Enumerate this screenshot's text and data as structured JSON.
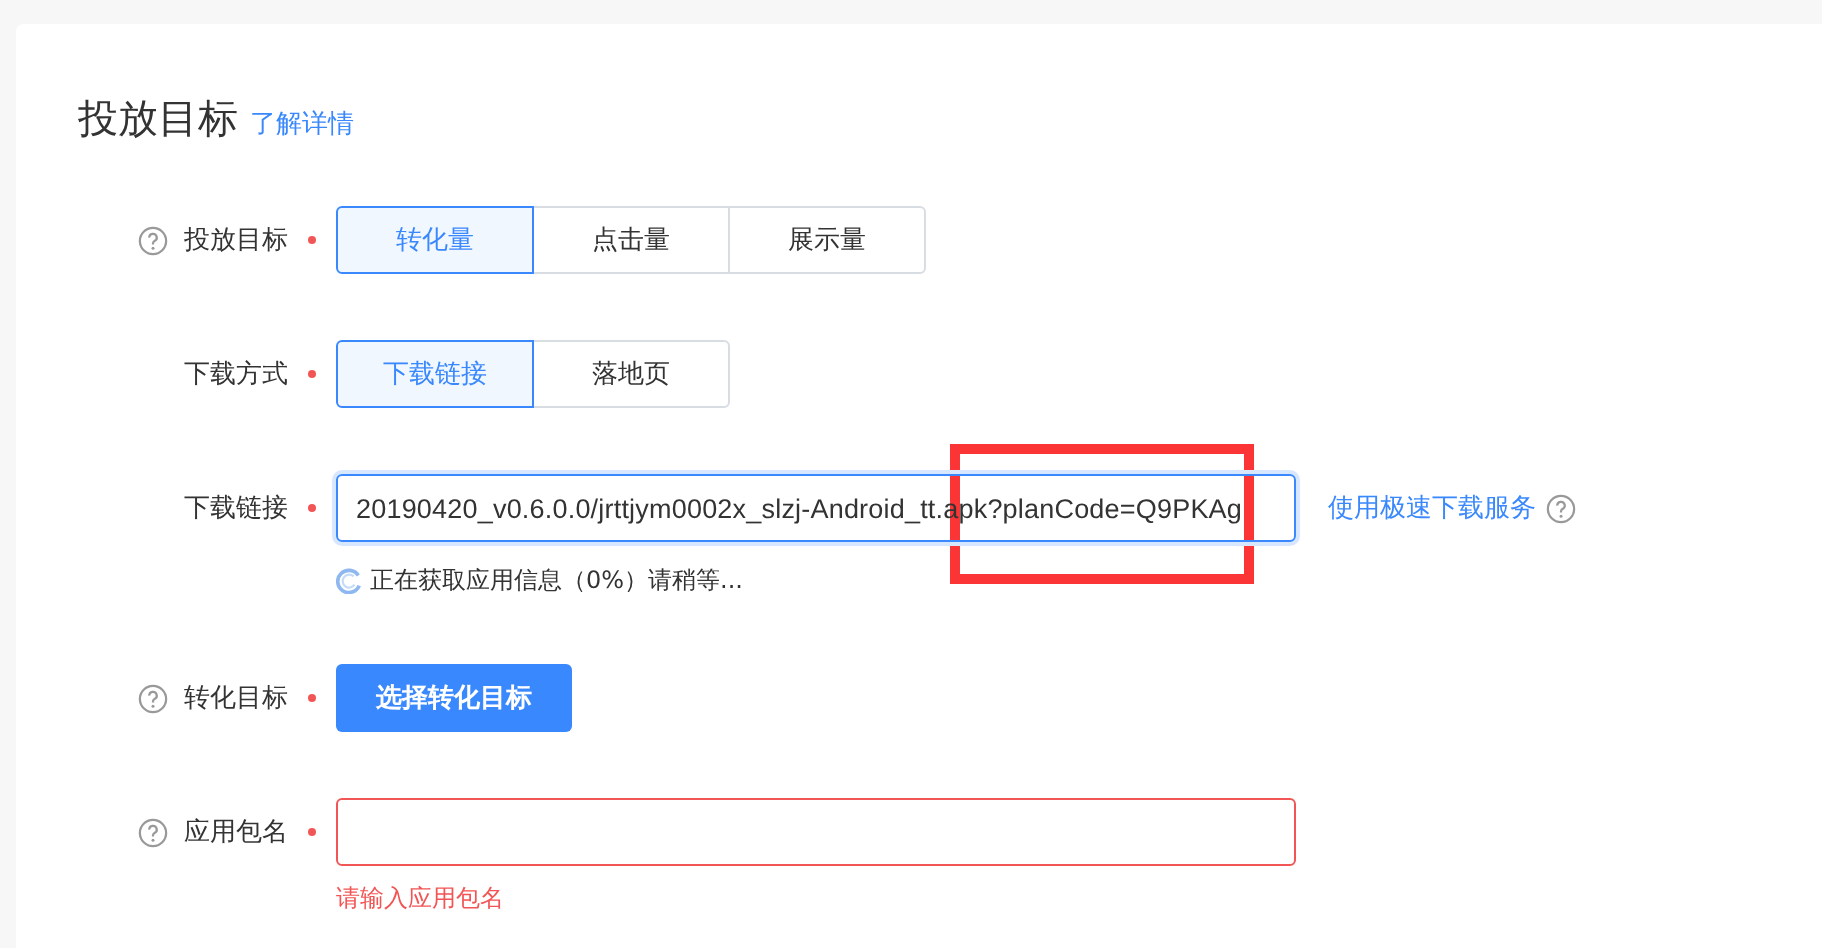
{
  "title": "投放目标",
  "title_link": "了解详情",
  "rows": [
    {
      "kind": "segments",
      "label": "投放目标",
      "help": true,
      "required": true,
      "options": [
        {
          "label": "转化量",
          "selected": true
        },
        {
          "label": "点击量",
          "selected": false
        },
        {
          "label": "展示量",
          "selected": false
        }
      ]
    },
    {
      "kind": "segments",
      "label": "下载方式",
      "help": false,
      "required": true,
      "options": [
        {
          "label": "下载链接",
          "selected": true
        },
        {
          "label": "落地页",
          "selected": false
        }
      ]
    },
    {
      "kind": "input",
      "label": "下载链接",
      "help": false,
      "required": true,
      "value": "20190420_v0.6.0.0/jrttjym0002x_slzj-Android_tt.apk?planCode=Q9PKAg",
      "focused": true,
      "error": false,
      "side_link": "使用极速下载服务",
      "status": "正在获取应用信息（0%）请稍等..."
    },
    {
      "kind": "button",
      "label": "转化目标",
      "help": true,
      "required": true,
      "button": "选择转化目标"
    },
    {
      "kind": "input",
      "label": "应用包名",
      "help": true,
      "required": true,
      "value": "",
      "focused": false,
      "error": true,
      "error_text": "请输入应用包名"
    }
  ]
}
